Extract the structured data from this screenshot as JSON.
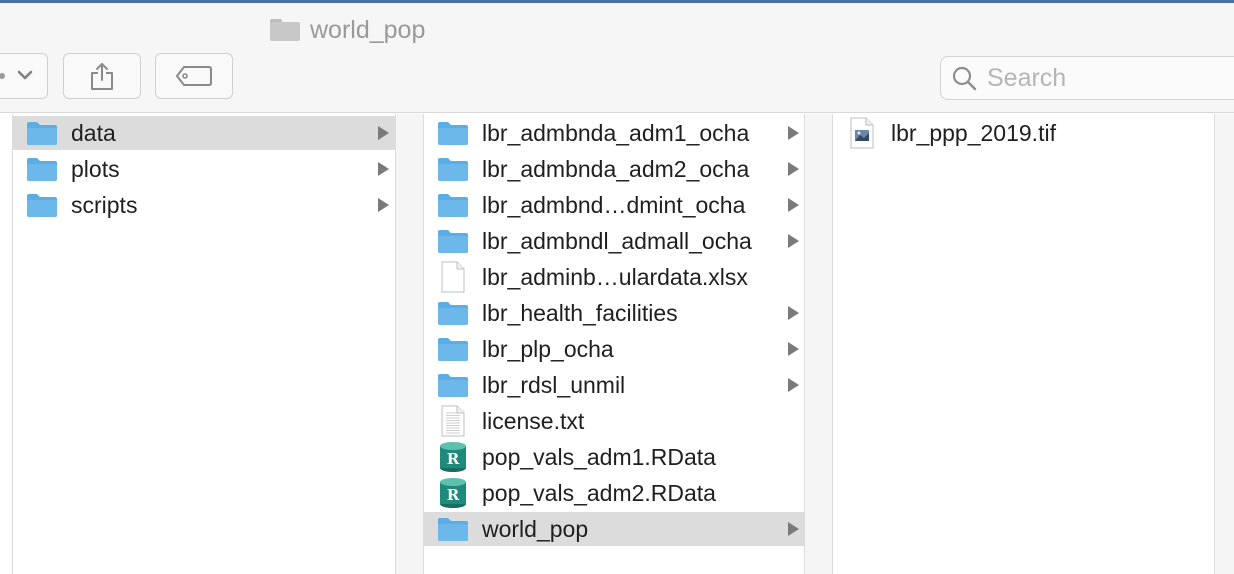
{
  "window": {
    "title": "world_pop"
  },
  "toolbar": {
    "search_placeholder": "Search"
  },
  "columns": {
    "first": [
      {
        "label": "data",
        "kind": "folder",
        "selected": true
      },
      {
        "label": "plots",
        "kind": "folder"
      },
      {
        "label": "scripts",
        "kind": "folder"
      }
    ],
    "second": [
      {
        "label": "lbr_admbnda_adm1_ocha",
        "kind": "folder"
      },
      {
        "label": "lbr_admbnda_adm2_ocha",
        "kind": "folder"
      },
      {
        "label": "lbr_admbnd…dmint_ocha",
        "kind": "folder"
      },
      {
        "label": "lbr_admbndl_admall_ocha",
        "kind": "folder"
      },
      {
        "label": "lbr_adminb…ulardata.xlsx",
        "kind": "file"
      },
      {
        "label": "lbr_health_facilities",
        "kind": "folder"
      },
      {
        "label": "lbr_plp_ocha",
        "kind": "folder"
      },
      {
        "label": "lbr_rdsl_unmil",
        "kind": "folder"
      },
      {
        "label": "license.txt",
        "kind": "text-file"
      },
      {
        "label": "pop_vals_adm1.RData",
        "kind": "rdata"
      },
      {
        "label": "pop_vals_adm2.RData",
        "kind": "rdata"
      },
      {
        "label": "world_pop",
        "kind": "folder",
        "selected": true
      }
    ],
    "third": [
      {
        "label": "lbr_ppp_2019.tif",
        "kind": "image-file"
      }
    ]
  },
  "colors": {
    "folder": "#6cb8ea",
    "selection": "#dcdcdc",
    "rdata": "#1f8a79"
  }
}
